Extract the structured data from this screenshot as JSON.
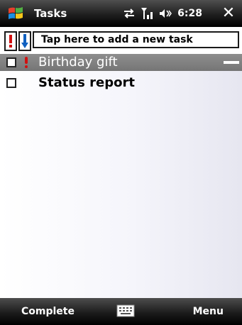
{
  "app": {
    "title": "Tasks",
    "time": "6:28"
  },
  "icons": {
    "start": "windows-flag-icon",
    "connectivity": "sync-arrows-icon",
    "signal": "signal-strength-icon",
    "volume": "speaker-icon",
    "close": "close-icon",
    "keyboard": "keyboard-icon",
    "priority_high": "exclamation-icon",
    "priority_low": "down-arrow-icon"
  },
  "new_task": {
    "placeholder": "Tap here to add a new task"
  },
  "tasks": [
    {
      "label": "Birthday gift",
      "selected": true,
      "completed": false,
      "priority": "high"
    },
    {
      "label": "Status report",
      "selected": false,
      "completed": false,
      "priority": "normal"
    }
  ],
  "softkeys": {
    "left": "Complete",
    "right": "Menu"
  },
  "colors": {
    "titlebar": "#1e1e1e",
    "selection": "#808080",
    "priority_high": "#d01010",
    "priority_low": "#1060c0"
  }
}
